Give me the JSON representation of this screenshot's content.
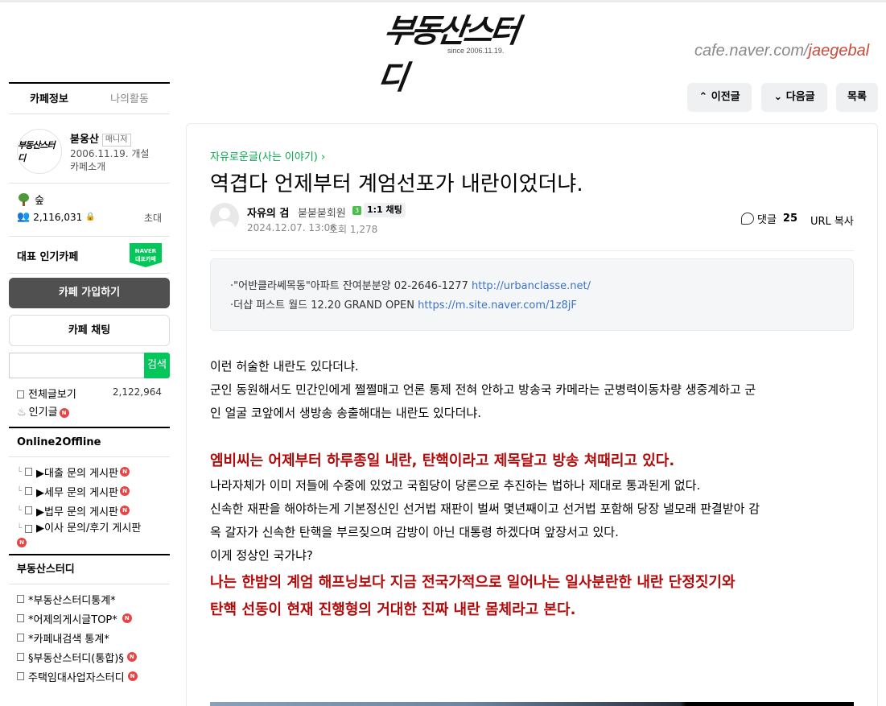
{
  "header": {
    "logo_text": "부동산스터디",
    "since": "since 2006.11.19.",
    "url_prefix": "cafe.naver.com/",
    "url_id": "jaegebal"
  },
  "sidebar": {
    "tabs": [
      "카페정보",
      "나의활동"
    ],
    "manager_name": "붇옹산",
    "manager_badge": "매니저",
    "established": "2006.11.19. 개설",
    "intro_link": "카페소개",
    "level": "숲",
    "member_count": "2,116,031",
    "invite": "초대",
    "rep_label": "대표 인기카페",
    "naver_badge_line1": "NAVER",
    "naver_badge_line2": "대표카페",
    "join_button": "카페 가입하기",
    "chat_button": "카페 채팅",
    "search_button": "검색",
    "all_posts_label": "전체글보기",
    "all_posts_count": "2,122,964",
    "my_comments_label": "인기글",
    "section1_title": "Online2Offline",
    "section1_items": [
      "▶대출 문의 게시판",
      "▶세무 문의 게시판",
      "▶법무 문의 게시판",
      "▶이사 문의/후기 게시판"
    ],
    "section2_title": "부동산스터디",
    "section2_items": [
      "*부동산스터디통계*",
      "*어제의게시글TOP*",
      "*카페내검색 통계*",
      "§부동산스터디(통합)§",
      "주택임대사업자스터디"
    ],
    "new_badge": "N"
  },
  "nav": {
    "prev": "이전글",
    "next": "다음글",
    "list": "목록"
  },
  "article": {
    "board": "자유로운글(사는 이야기)",
    "title": "역겹다 언제부터 계엄선포가 내란이었더냐.",
    "author": "자유의 검",
    "grade": "붇붇붇회원",
    "grade_level": "3",
    "chat_chip": "1:1 채팅",
    "date": "2024.12.07. 13:06",
    "views": "조회 1,278",
    "comment_label": "댓글",
    "comment_count": "25",
    "url_copy": "URL 복사",
    "ad1_text": "·\"어반클라쎄목동\"아파트 잔여분분양 02-2646-1277 ",
    "ad1_link": "http://urbanclasse.net/",
    "ad2_text": "·더샵 퍼스트 월드 12.20 GRAND OPEN ",
    "ad2_link": "https://m.site.naver.com/1z8jF",
    "p1": "이런 허술한 내란도 있다더냐.",
    "p2": "군인 동원해서도 민간인에게 쩔쩔매고 언론 통제 전혀 안하고 방송국 카메라는 군병력이동차량 생중계하고 군",
    "p3": "인 얼굴 코앞에서 생방송 송출해대는 내란도 있다더냐.",
    "red1": "엠비씨는 어제부터 하루종일 내란, 탄핵이라고 제목달고 방송 쳐때리고 있다.",
    "p4": "나라자체가 이미 저들에 수중에 있었고 국힘당이 당론으로 추진하는 법하나 제대로 통과된게 없다.",
    "p5": "신속한 재판을 해야하는게 기본정신인 선거법 재판이 벌써 몇년째이고 선거법 포함해 당장 낼모래 판결받아 감",
    "p6": "옥 갈자가 신속한 탄핵을 부르짖으며 감방이 아닌 대통령 하겠다며 앞장서고 있다.",
    "p7": "이게 정상인 국가냐?",
    "red2": "나는 한밤의 계엄 해프닝보다 지금 전국가적으로 일어나는 일사분란한 내란 단정짓기와",
    "red3": "탄핵 선동이 현재 진행형의 거대한 진짜 내란 몸체라고 본다."
  },
  "colors": {
    "naver_green": "#03c75a",
    "board_link": "#03a94e",
    "emphasis_red": "#b00b0b",
    "link_blue": "#3b73c9"
  }
}
